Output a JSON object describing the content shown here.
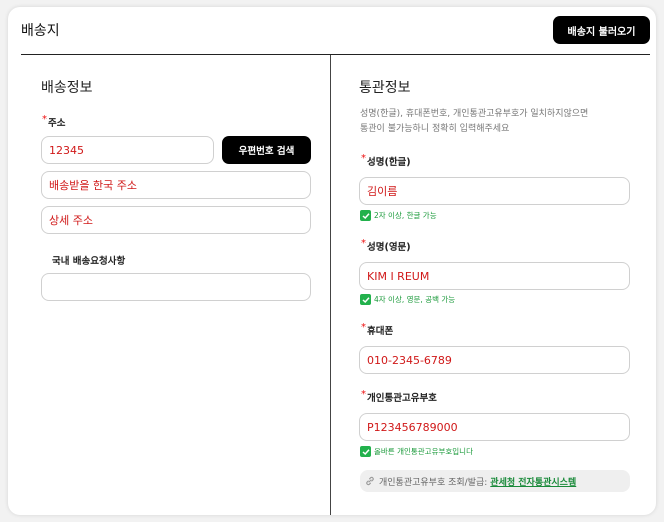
{
  "header": {
    "title": "배송지",
    "load_button": "배송지 불러오기"
  },
  "shipping": {
    "title": "배송정보",
    "address_label": "주소",
    "zip_value": "12345",
    "zip_search_button": "우편번호 검색",
    "address1_value": "배송받을 한국 주소",
    "address2_value": "상세 주소",
    "request_label": "국내 배송요청사항",
    "request_value": ""
  },
  "customs": {
    "title": "통관정보",
    "description_line1": "성명(한글), 휴대폰번호, 개인통관고유부호가 일치하지않으면",
    "description_line2": "통관이 불가능하니 정확히 입력해주세요",
    "name_kr_label": "성명(한글)",
    "name_kr_value": "김이름",
    "name_kr_hint": "2자 이상, 한글 가능",
    "name_en_label": "성명(영문)",
    "name_en_value": "KIM I REUM",
    "name_en_hint": "4자 이상, 영문, 공백 가능",
    "phone_label": "휴대폰",
    "phone_value": "010-2345-6789",
    "pccc_label": "개인통관고유부호",
    "pccc_value": "P123456789000",
    "pccc_hint": "올바른 개인통관고유부호입니다",
    "lookup_text": "개인통관고유부호 조회/발급:",
    "lookup_link": "관세청 전자통관시스템"
  },
  "colors": {
    "required": "#e11111",
    "value_text": "#d01818",
    "success": "#22b14c",
    "button_bg": "#000000"
  },
  "icons": [
    "check-icon",
    "link-icon"
  ]
}
